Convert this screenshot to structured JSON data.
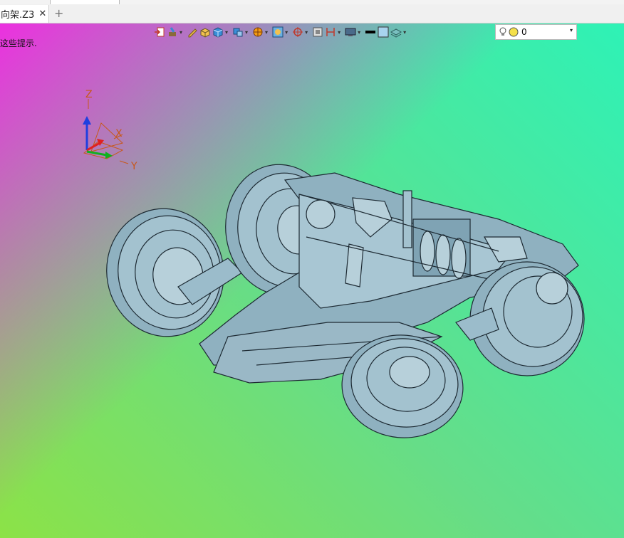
{
  "tab": {
    "label": "向架.Z3",
    "close_glyph": "✕",
    "add_glyph": "+"
  },
  "viewport": {
    "hint_text": "这些提示.",
    "layer_combo": {
      "value": "0",
      "arrow": "▾"
    },
    "axes": {
      "z": "Z",
      "x": "X",
      "y": "Y"
    }
  },
  "toolbar_icons": [
    "import-icon",
    "paint-icon",
    "pencil-icon",
    "box-icon",
    "cube-icon",
    "cube-shaded-icon",
    "render-icon",
    "view-frame-icon",
    "target-icon",
    "section-icon",
    "dimension-icon",
    "monitor-icon",
    "line-color-icon",
    "fill-color-icon",
    "layer-stack-icon",
    "light-bulb-icon"
  ],
  "colors": {
    "model_fill": "#8fb1c0",
    "model_stroke": "#1d2a33",
    "axis_z": "#1f3fe0",
    "axis_x": "#e02020",
    "axis_y": "#10b020",
    "axis_label": "#c8581a"
  }
}
